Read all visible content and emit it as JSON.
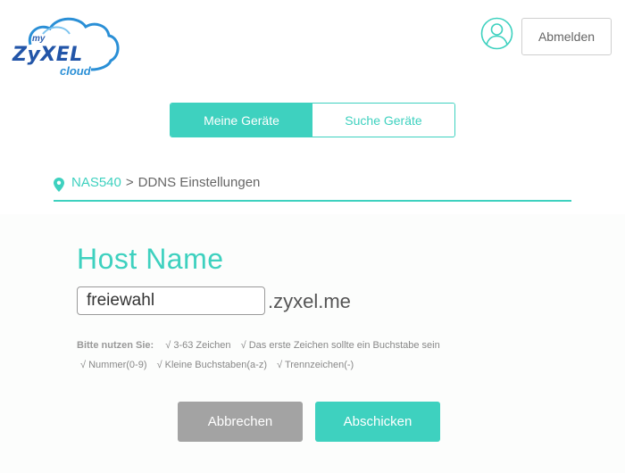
{
  "logo": {
    "my": "my",
    "brand": "ZyXEL",
    "cloud": "cloud"
  },
  "header": {
    "logout_label": "Abmelden"
  },
  "tabs": [
    {
      "label": "Meine Geräte",
      "active": true
    },
    {
      "label": "Suche Geräte",
      "active": false
    }
  ],
  "breadcrumb": {
    "device": "NAS540",
    "separator": ">",
    "page": "DDNS Einstellungen"
  },
  "host": {
    "title": "Host Name",
    "input_value": "freiewahl",
    "suffix": ".zyxel.me"
  },
  "hints": {
    "label": "Bitte nutzen Sie:",
    "rules_row1": [
      "√ 3-63 Zeichen",
      "√ Das erste Zeichen sollte ein Buchstabe sein"
    ],
    "rules_row2": [
      "√ Nummer(0-9)",
      "√ Kleine Buchstaben(a-z)",
      "√ Trennzeichen(-)"
    ]
  },
  "actions": {
    "cancel_label": "Abbrechen",
    "submit_label": "Abschicken"
  },
  "colors": {
    "accent": "#3ed1bf",
    "cancel": "#a3a3a3",
    "brand_blue": "#2255a8"
  },
  "icons": {
    "user": "user-icon",
    "location": "location-pin-icon"
  }
}
